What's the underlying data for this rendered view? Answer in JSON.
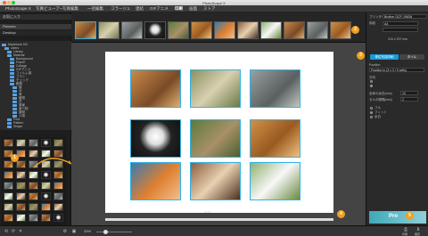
{
  "window": {
    "title": "PhotoScape X"
  },
  "menu": [
    "PhotoScape X",
    "写真ビューアー",
    "写真編集",
    "一括編集",
    "コラージュ",
    "連結",
    "GIFアニメ",
    "印刷",
    "画面",
    "ストア"
  ],
  "menu_active_index": 7,
  "left_panel": {
    "header": "お気に入り",
    "section": "Pictures",
    "sub": "Desktop",
    "tree": [
      "Macintosh HD",
      "Users",
      "Library",
      "Material",
      "Background",
      "Frame",
      "Collage",
      "GIFアニメ",
      "フィルム風",
      "ブラシ",
      "チェック",
      "動物",
      "猫",
      "犬",
      "鳥",
      "植物",
      "花",
      "風景",
      "食べ物",
      "建物",
      "人物",
      "Font",
      "Pattern",
      "Shape"
    ]
  },
  "right_panel": {
    "printer_label": "プリンター",
    "printer_value": "Brother DCP-J963N",
    "paper_label": "用紙",
    "paper_value": "A4",
    "size_text": "210 x 297 mm",
    "tab_layout": "単位写真印刷",
    "tab_tile": "タイル",
    "position_label": "Position",
    "position_value": "Position in (3 x 3 / 9 cells)",
    "orientation_label": "方向",
    "margin_label": "全体の余白(mm)",
    "margin_value": "10",
    "gap_label": "セルの間隔(mm)",
    "gap_value": "2",
    "fit_options": [
      "フル",
      "フィット",
      "余白"
    ]
  },
  "canvas": {
    "page_indicator": "1 / 1"
  },
  "bottom_bar": {
    "zoom": "33%",
    "print_label": "印刷",
    "save_label": "保存"
  },
  "markers": [
    "1",
    "2",
    "3",
    "4",
    "5"
  ],
  "ad_banner": "Pro"
}
